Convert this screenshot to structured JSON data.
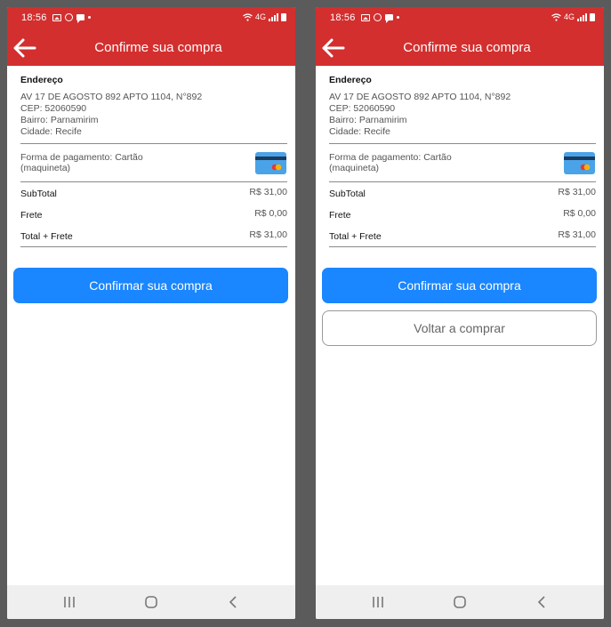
{
  "screens": [
    {
      "status": {
        "time": "18:56",
        "net": "4G"
      },
      "appbar": {
        "title": "Confirme sua compra"
      },
      "address": {
        "title": "Endereço",
        "street": "AV 17 DE AGOSTO 892 APTO 1104, N°892",
        "cep": " CEP: 52060590",
        "bairro": " Bairro: Parnamirim",
        "cidade": " Cidade: Recife"
      },
      "payment": {
        "line1": "Forma de pagamento: Cartão",
        "line2": "(maquineta)"
      },
      "summary": [
        {
          "label": "SubTotal",
          "value": "R$ 31,00"
        },
        {
          "label": "Frete",
          "value": "R$ 0,00"
        },
        {
          "label": "Total + Frete",
          "value": "R$ 31,00"
        }
      ],
      "confirm_label": "Confirmar sua compra"
    },
    {
      "status": {
        "time": "18:56",
        "net": "4G"
      },
      "appbar": {
        "title": "Confirme sua compra"
      },
      "address": {
        "title": "Endereço",
        "street": "AV 17 DE AGOSTO 892 APTO 1104, N°892",
        "cep": " CEP: 52060590",
        "bairro": " Bairro: Parnamirim",
        "cidade": " Cidade: Recife"
      },
      "payment": {
        "line1": "Forma de pagamento: Cartão",
        "line2": "(maquineta)"
      },
      "summary": [
        {
          "label": "SubTotal",
          "value": "R$ 31,00"
        },
        {
          "label": "Frete",
          "value": "R$ 0,00"
        },
        {
          "label": "Total + Frete",
          "value": "R$ 31,00"
        }
      ],
      "confirm_label": "Confirmar sua compra",
      "back_shopping_label": "Voltar a comprar"
    }
  ],
  "colors": {
    "accent": "#d32f2f",
    "primary_button": "#1a86ff",
    "background": "#5b5b5b"
  },
  "icons": [
    "gallery-icon",
    "whatsapp-icon",
    "message-icon",
    "wifi-icon",
    "signal-icon",
    "battery-icon",
    "back-arrow-icon",
    "credit-card-icon",
    "recents-icon",
    "home-icon",
    "nav-back-icon"
  ]
}
